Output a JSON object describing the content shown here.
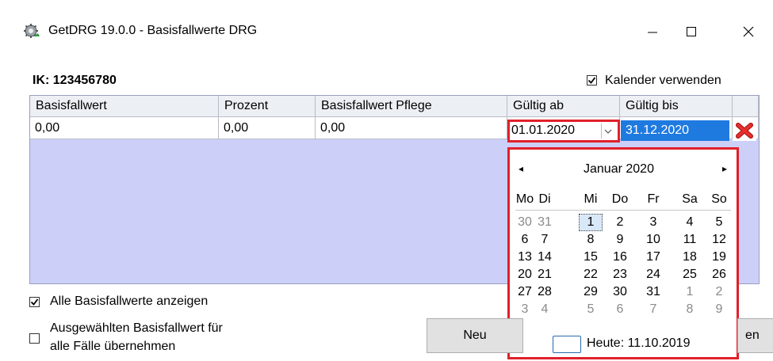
{
  "window": {
    "title": "GetDRG 19.0.0 - Basisfallwerte DRG",
    "controls": {
      "minimize": "—",
      "maximize": "☐",
      "close": "✕"
    }
  },
  "header": {
    "ik_label": "IK:  123456780",
    "calendar_checkbox_label": "Kalender verwenden",
    "calendar_checkbox_checked": true
  },
  "grid": {
    "columns": [
      "Basisfallwert",
      "Prozent",
      "Basisfallwert Pflege",
      "Gültig ab",
      "Gültig bis"
    ],
    "row": {
      "basisfallwert": "0,00",
      "prozent": "0,00",
      "basisfallwert_pflege": "0,00",
      "gueltig_ab": "01.01.2020",
      "gueltig_bis": "31.12.2020"
    },
    "delete_icon": "red-x-delete-icon"
  },
  "calendar": {
    "month_label": "Januar 2020",
    "prev": "◂",
    "next": "▸",
    "weekdays": [
      "Mo",
      "Di",
      "Mi",
      "Do",
      "Fr",
      "Sa",
      "So"
    ],
    "weeks": [
      [
        "30",
        "31",
        "1",
        "2",
        "3",
        "4",
        "5"
      ],
      [
        "6",
        "7",
        "8",
        "9",
        "10",
        "11",
        "12"
      ],
      [
        "13",
        "14",
        "15",
        "16",
        "17",
        "18",
        "19"
      ],
      [
        "20",
        "21",
        "22",
        "23",
        "24",
        "25",
        "26"
      ],
      [
        "27",
        "28",
        "29",
        "30",
        "31",
        "1",
        "2"
      ],
      [
        "3",
        "4",
        "5",
        "6",
        "7",
        "8",
        "9"
      ]
    ],
    "selected_day": "1",
    "today_label": "Heute: 11.10.2019"
  },
  "footer": {
    "show_all_label": "Alle Basisfallwerte anzeigen",
    "show_all_checked": true,
    "apply_all_label_line1": "Ausgewählten Basisfallwert für",
    "apply_all_label_line2": "alle Fälle übernehmen",
    "apply_all_checked": false,
    "new_button": "Neu",
    "partial_button": "en"
  },
  "colors": {
    "accent_red": "#e0202a",
    "selection_blue": "#1f7ae0",
    "grid_bg": "#ccd0f8"
  }
}
